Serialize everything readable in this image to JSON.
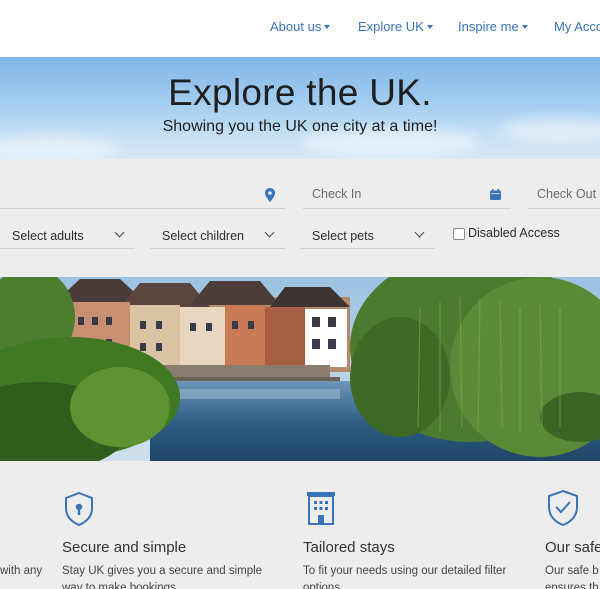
{
  "nav": {
    "items": [
      {
        "label": "About us"
      },
      {
        "label": "Explore UK"
      },
      {
        "label": "Inspire me"
      },
      {
        "label": "My Acco"
      }
    ]
  },
  "hero": {
    "title": "Explore the UK.",
    "subtitle": "Showing you the UK one city at a time!"
  },
  "search": {
    "check_in_placeholder": "Check In",
    "check_out_placeholder": "Check Out",
    "adults": "Select adults",
    "children": "Select children",
    "pets": "Select pets",
    "disabled_access_label": "Disabled Access",
    "disabled_access_checked": false
  },
  "features": {
    "left_fragment": "with any",
    "items": [
      {
        "title": "Secure and simple",
        "line1": "Stay UK gives you a secure and simple",
        "line2": "way to make bookings",
        "icon": "shield-lock-icon"
      },
      {
        "title": "Tailored stays",
        "line1": "To fit your needs using our detailed filter",
        "line2": "options",
        "icon": "building-icon"
      },
      {
        "title": "Our safe",
        "line1": "Our safe b",
        "line2": "ensures th",
        "icon": "shield-check-icon"
      }
    ]
  },
  "colors": {
    "accent": "#3b73b9",
    "panel": "#ededed"
  }
}
